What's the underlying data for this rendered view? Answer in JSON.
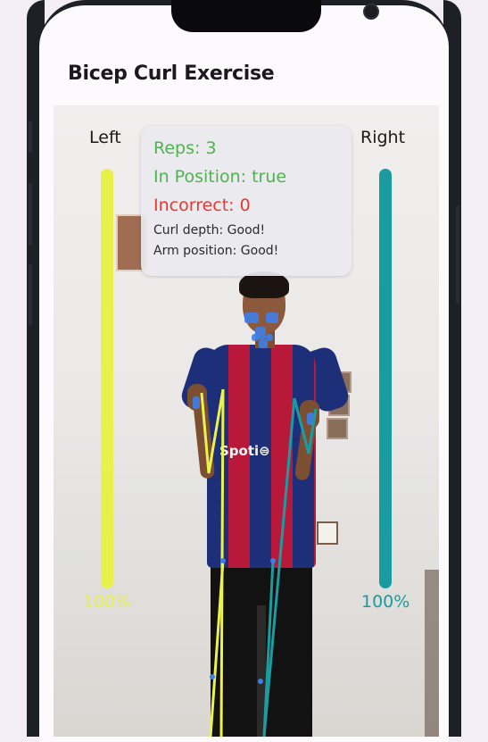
{
  "app": {
    "title": "Bicep Curl Exercise"
  },
  "bars": {
    "left": {
      "label": "Left",
      "percent_text": "100%",
      "level": 1.0,
      "color": "#e8f14a"
    },
    "right": {
      "label": "Right",
      "percent_text": "100%",
      "level": 1.0,
      "color": "#1a9ba0"
    }
  },
  "stats": {
    "reps": "Reps: 3",
    "in_position": "In Position: true",
    "incorrect": "Incorrect: 0",
    "curl_depth": "Curl depth: Good!",
    "arm_position": "Arm position: Good!"
  },
  "colors": {
    "good": "#4fb34f",
    "bad": "#e53935",
    "left_skeleton": "#ecf24d",
    "right_skeleton": "#1b9ca1",
    "landmark": "#3f7ee6"
  },
  "icons": [
    "front-camera-icon"
  ]
}
